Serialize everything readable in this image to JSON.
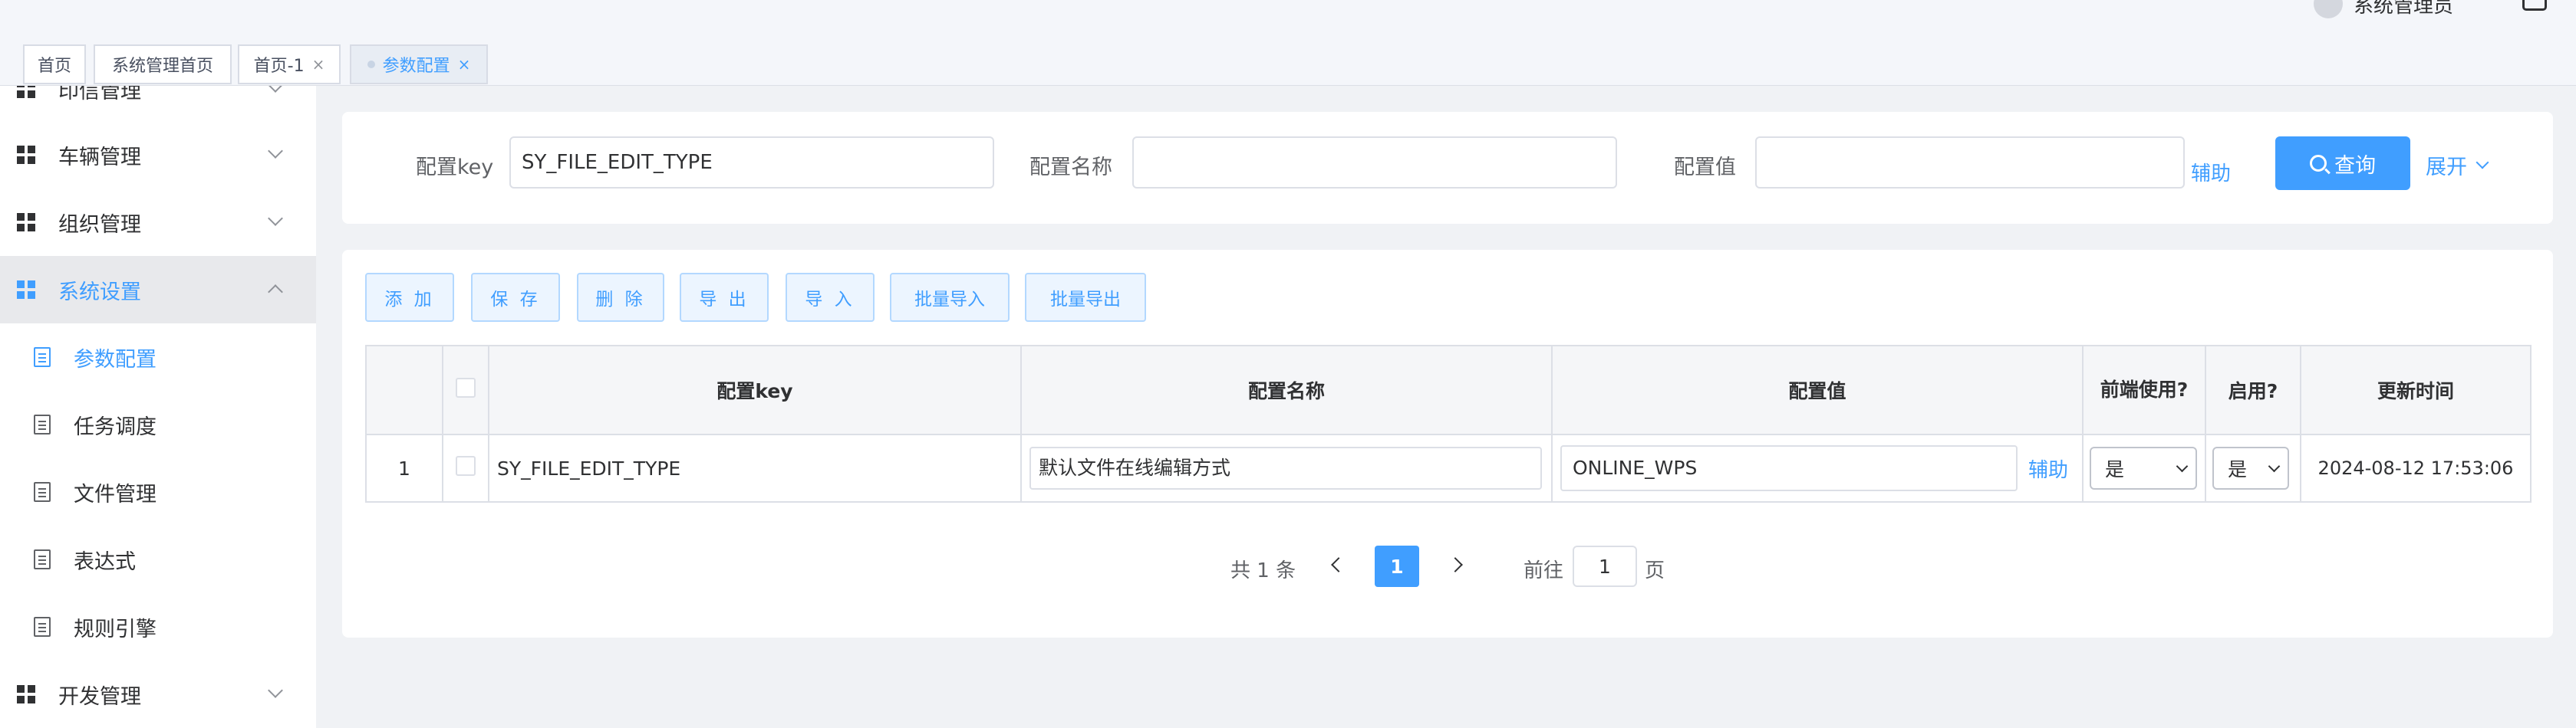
{
  "header": {
    "user_name": "系统管理员"
  },
  "tabs": [
    {
      "label": "首页",
      "closable": false,
      "active": false
    },
    {
      "label": "系统管理首页",
      "closable": false,
      "active": false
    },
    {
      "label": "首页-1",
      "closable": true,
      "active": false
    },
    {
      "label": "参数配置",
      "closable": true,
      "active": true
    }
  ],
  "tab_close_glyph": "×",
  "sidebar": {
    "top_partial_label": "印信管理",
    "menus": [
      {
        "label": "车辆管理",
        "expanded": false
      },
      {
        "label": "组织管理",
        "expanded": false
      },
      {
        "label": "系统设置",
        "expanded": true
      },
      {
        "label": "开发管理",
        "expanded": false
      }
    ],
    "sub_items": [
      {
        "label": "参数配置",
        "active": true
      },
      {
        "label": "任务调度",
        "active": false
      },
      {
        "label": "文件管理",
        "active": false
      },
      {
        "label": "表达式",
        "active": false
      },
      {
        "label": "规则引擎",
        "active": false
      }
    ]
  },
  "search": {
    "key_label": "配置key",
    "key_value": "SY_FILE_EDIT_TYPE",
    "name_label": "配置名称",
    "name_value": "",
    "value_label": "配置值",
    "value_value": "",
    "aux_label": "辅助",
    "query_label": "查询",
    "expand_label": "展开"
  },
  "toolbar": {
    "add": "添 加",
    "save": "保 存",
    "delete": "删 除",
    "export": "导 出",
    "import": "导 入",
    "batch_import": "批量导入",
    "batch_export": "批量导出"
  },
  "table": {
    "columns": {
      "key": "配置key",
      "name": "配置名称",
      "value": "配置值",
      "frontend": "前端使用?",
      "enabled": "启用?",
      "updated": "更新时间"
    },
    "rows": [
      {
        "index": "1",
        "key": "SY_FILE_EDIT_TYPE",
        "name": "默认文件在线编辑方式",
        "value": "ONLINE_WPS",
        "aux": "辅助",
        "frontend": "是",
        "enabled": "是",
        "updated": "2024-08-12 17:53:06"
      }
    ]
  },
  "pagination": {
    "total_text": "共 1 条",
    "current_page": "1",
    "goto_prefix": "前往",
    "goto_value": "1",
    "goto_suffix": "页"
  },
  "colors": {
    "accent": "#409eff",
    "sidebar_active_bg": "#e8e9ec",
    "page_bg": "#f0f2f5"
  }
}
